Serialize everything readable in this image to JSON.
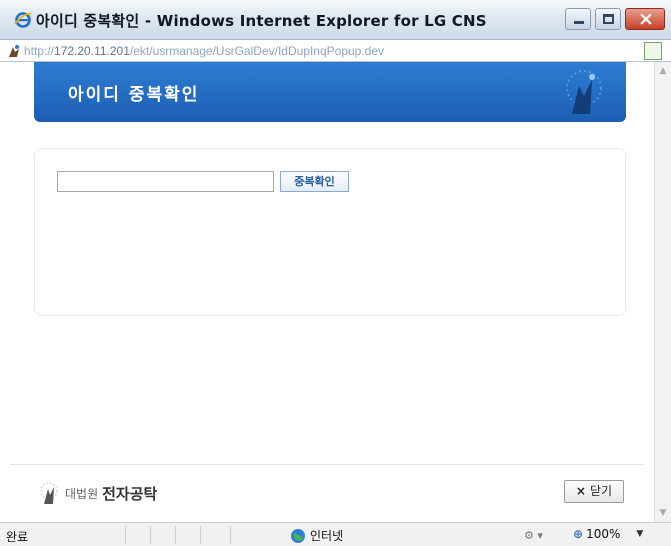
{
  "window": {
    "title": "아이디 중복확인 - Windows Internet Explorer for LG CNS",
    "url_prefix": "http://",
    "url_host": "172.20.11.201",
    "url_path": "/ekt/usrmanage/UsrGalDev/IdDupInqPopup.dev"
  },
  "header": {
    "title": "아이디 중복확인"
  },
  "form": {
    "id_value": "",
    "check_button": "중복확인"
  },
  "footer": {
    "org": "대법원",
    "brand": "전자공탁",
    "close_label": "닫기",
    "close_symbol": "×"
  },
  "statusbar": {
    "status": "완료",
    "zone": "인터넷",
    "zoom": "100%"
  },
  "colors": {
    "header_blue": "#2e7dd2",
    "button_text": "#2b5e9c"
  }
}
